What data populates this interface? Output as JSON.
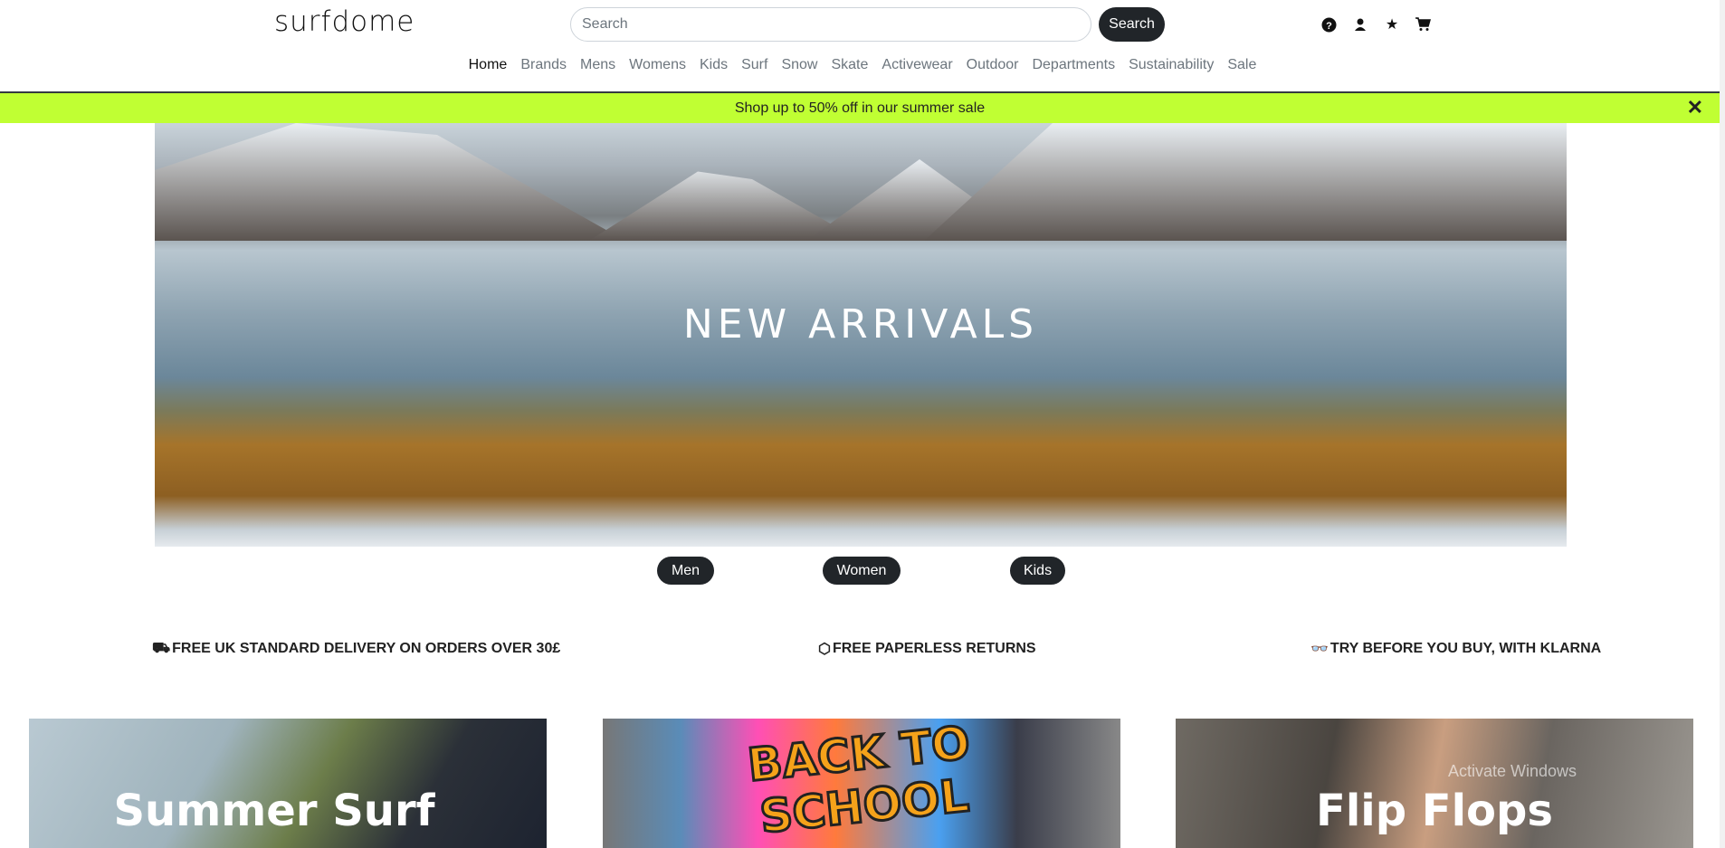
{
  "header": {
    "logo": "surfdome",
    "search_placeholder": "Search",
    "search_button": "Search",
    "icons": [
      "help-icon",
      "account-icon",
      "wishlist-star-icon",
      "cart-icon"
    ]
  },
  "nav": [
    "Home",
    "Brands",
    "Mens",
    "Womens",
    "Kids",
    "Surf",
    "Snow",
    "Skate",
    "Activewear",
    "Outdoor",
    "Departments",
    "Sustainability",
    "Sale"
  ],
  "promo": {
    "text": "Shop up to 50% off in our summer sale",
    "color": "#c0ff33"
  },
  "hero": {
    "title": "NEW ARRIVALS",
    "buttons": [
      "Men",
      "Women",
      "Kids"
    ]
  },
  "features": [
    {
      "icon": "truck-icon",
      "text": "FREE UK STANDARD DELIVERY ON ORDERS OVER 30£"
    },
    {
      "icon": "box-icon",
      "text": "FREE PAPERLESS RETURNS"
    },
    {
      "icon": "glasses-icon",
      "text": "TRY BEFORE YOU BUY, WITH KLARNA"
    }
  ],
  "cards": [
    {
      "title": "Summer Surf"
    },
    {
      "title": "BACK TO SCHOOL"
    },
    {
      "title": "Flip Flops"
    }
  ],
  "watermark": "Activate Windows"
}
